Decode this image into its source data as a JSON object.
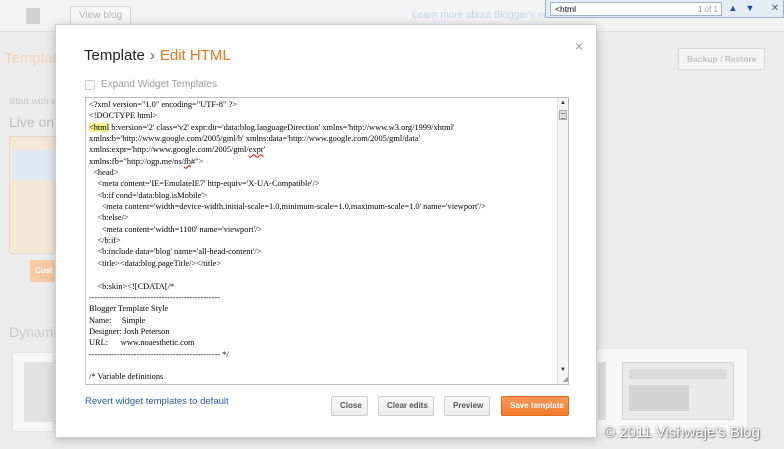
{
  "background": {
    "view_blog_label": "View blog",
    "learn_more_text": "Learn more about Blogger's new loo",
    "template_heading": "Templat",
    "backup_restore_label": "Backup / Restore",
    "start_with_text": "Start with a",
    "live_on_text": "Live on B",
    "customize_label": "Cust",
    "dynamic_text": "Dynami"
  },
  "find_bar": {
    "query": "<html",
    "count": "1 of 1",
    "icons": [
      "chevron-up-icon",
      "chevron-down-icon",
      "close-icon"
    ]
  },
  "modal": {
    "breadcrumb_parent": "Template",
    "breadcrumb_separator": "›",
    "breadcrumb_current": "Edit HTML",
    "close_icon": "×",
    "expand_widget_label": "Expand Widget Templates",
    "expand_widget_checked": false,
    "code_lines": [
      "<?xml version=\"1.0\" encoding=\"UTF-8\" ?>",
      "<!DOCTYPE html>",
      "<html b:version='2' class='v2' expr:dir='data:blog.languageDirection' xmlns='http://www.w3.org/1999/xhtml'",
      "xmlns:b='http://www.google.com/2005/gml/b' xmlns:data='http://www.google.com/2005/gml/data'",
      "xmlns:expr='http://www.google.com/2005/gml/expr'",
      "xmlns:fb=\"http://ogp.me/ns/fb#\">",
      "  <head>",
      "    <meta content='IE=EmulateIE7' http-equiv='X-UA-Compatible'/>",
      "    <b:if cond='data:blog.isMobile'>",
      "      <meta content='width=device-width,initial-scale=1.0,minimum-scale=1.0,maximum-scale=1.0' name='viewport'/>",
      "    <b:else/>",
      "      <meta content='width=1100' name='viewport'/>",
      "    </b:if>",
      "    <b:include data='blog' name='all-head-content'/>",
      "    <title><data:blog.pageTitle/></title>",
      "",
      "    <b:skin><![CDATA[/*",
      "-----------------------------------------------",
      "Blogger Template Style",
      "Name:     Simple",
      "Designer: Josh Peterson",
      "URL:      www.noaesthetic.com",
      "----------------------------------------------- */",
      "",
      "/* Variable definitions"
    ],
    "revert_link": "Revert widget templates to default",
    "buttons": {
      "close": "Close",
      "clear_edits": "Clear edits",
      "preview": "Preview",
      "save": "Save template"
    }
  },
  "watermark": "© 2011 Vishwaje's Blog",
  "colors": {
    "accent_orange": "#e8751a",
    "save_button": "#ef7a2e",
    "link_blue": "#2a5db0",
    "find_highlight": "#f6f18c"
  }
}
